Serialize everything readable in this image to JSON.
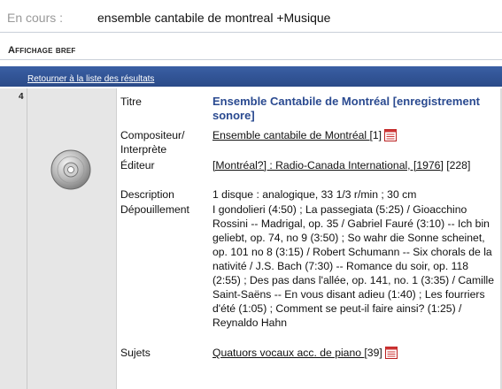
{
  "search": {
    "label": "En cours :",
    "query": "ensemble cantabile de montreal +Musique"
  },
  "section": {
    "title": "Affichage bref"
  },
  "nav": {
    "back_link": "Retourner à la liste des résultats"
  },
  "record": {
    "number": "4",
    "media_icon": "cd-disc-icon",
    "fields": {
      "titre": {
        "label": "Titre",
        "value": "Ensemble Cantabile de Montréal [enregistrement sonore]"
      },
      "compositeur": {
        "label": "Compositeur/ Interprète",
        "link": "Ensemble cantabile de Montréal ",
        "count": "[1]"
      },
      "editeur": {
        "label": "Éditeur",
        "link": "[Montréal?] : Radio-Canada International, [1976]",
        "count": "[228]"
      },
      "description": {
        "label": "Description",
        "value": "1 disque : analogique, 33 1/3 r/min ; 30 cm"
      },
      "depouillement": {
        "label": "Dépouillement",
        "value": "I gondolieri (4:50) ; La passegiata (5:25) / Gioacchino Rossini -- Madrigal, op. 35 / Gabriel Fauré (3:10) -- Ich bin geliebt, op. 74, no 9 (3:50) ; So wahr die Sonne scheinet, op. 101 no 8 (3:15) / Robert Schumann -- Six chorals de la nativité / J.S. Bach (7:30) -- Romance du soir, op. 118 (2:55) ; Des pas dans l'allée, op. 141, no. 1 (3:35) / Camille Saint-Saëns -- En vous disant adieu (1:40) ; Les fourriers d'été (1:05) ; Comment se peut-il faire ainsi? (1:25) / Reynaldo Hahn"
      },
      "sujets": {
        "label": "Sujets",
        "link": "Quatuors vocaux acc. de piano ",
        "count": "[39]"
      }
    },
    "list_icon": "document-list-icon"
  }
}
